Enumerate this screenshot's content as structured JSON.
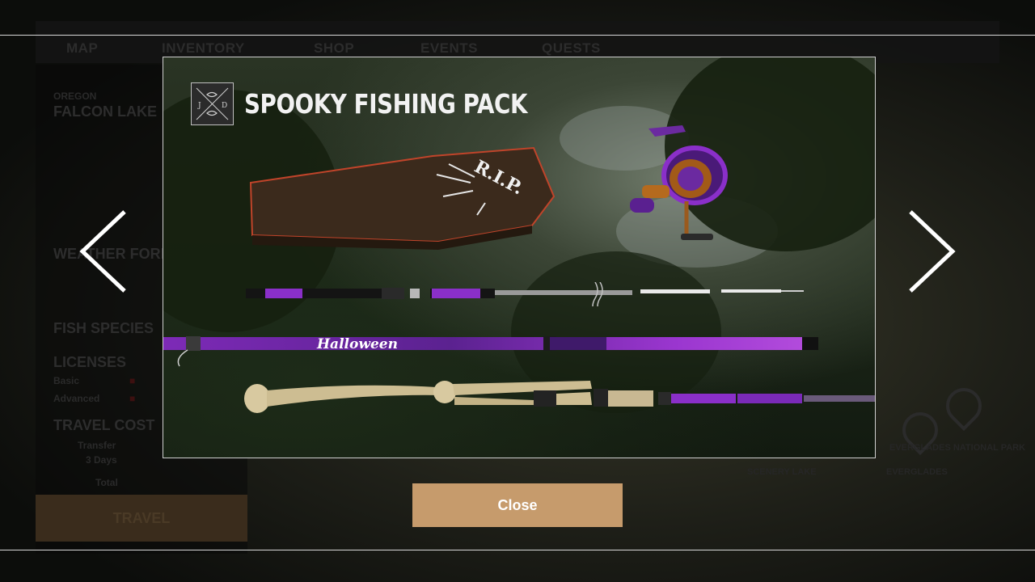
{
  "background": {
    "tabs": [
      "MAP",
      "INVENTORY",
      "SHOP",
      "EVENTS",
      "QUESTS"
    ],
    "panel": {
      "region": "OREGON",
      "location": "FALCON LAKE",
      "weather_heading": "WEATHER FORECAST",
      "fish_species": "FISH SPECIES",
      "licenses": "LICENSES",
      "license_rows": [
        "Basic",
        "Advanced"
      ],
      "travel_cost": "TRAVEL COST",
      "travel_rows": [
        "Transfer",
        "3 Days",
        "Total"
      ],
      "travel_button": "TRAVEL"
    },
    "map_labels": [
      "SCENERY LAKE",
      "EVERGLADES",
      "EVERGLADES NATIONAL PARK"
    ]
  },
  "modal": {
    "title": "SPOOKY FISHING PACK",
    "items": [
      {
        "name": "coffin rod case",
        "label": "R.I.P."
      },
      {
        "name": "purple spinning reel"
      },
      {
        "name": "purple telescopic rod"
      },
      {
        "name": "Halloween rod",
        "label": "Halloween"
      },
      {
        "name": "bone rod"
      }
    ]
  },
  "navigation": {
    "prev_icon": "chevron-left-icon",
    "next_icon": "chevron-right-icon"
  },
  "close_button": {
    "label": "Close"
  },
  "colors": {
    "close_button": "#c69b6c",
    "modal_border": "#cfcfcf",
    "title": "#f2f2f2",
    "purple_accent": "#8a2fc9",
    "coffin_border": "#c0442a"
  }
}
